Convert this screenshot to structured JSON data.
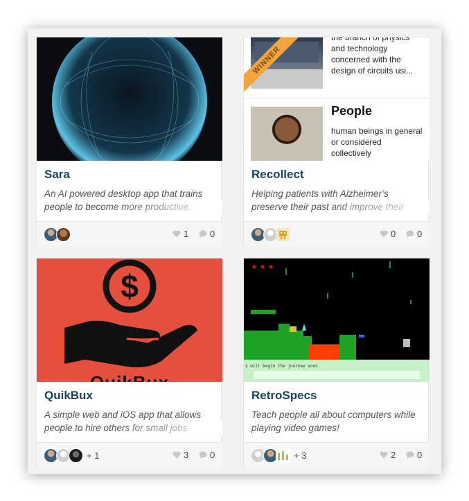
{
  "cards": [
    {
      "title": "Sara",
      "description": "An AI powered desktop app that trains people to become more productive.",
      "likes": "1",
      "comments": "0",
      "more": ""
    },
    {
      "title": "Recollect",
      "description": "Helping patients with Alzheimer’s preserve their past and improve their",
      "likes": "0",
      "comments": "0",
      "more": "",
      "thumb": {
        "badge": "WINNER",
        "word1_text": "the branch of physics and technology concerned with the design of circuits usi...",
        "word2_title": "People",
        "word2_text": "human beings in general or considered collectively"
      }
    },
    {
      "title": "QuikBux",
      "description": "A simple web and iOS app that allows people to hire others for small jobs",
      "likes": "3",
      "comments": "0",
      "more": "+ 1",
      "thumb": {
        "logo_text": "QuikBux"
      }
    },
    {
      "title": "RetroSpecs",
      "description": "Teach people all about computers while playing video games!",
      "likes": "2",
      "comments": "0",
      "more": "+ 3",
      "thumb": {
        "dialog_text": "s will begin the journey soon."
      }
    }
  ],
  "colors": {
    "title": "#15465c",
    "quikbux_bg": "#e4503d",
    "game_green": "#1fa327",
    "game_lava": "#ff3d00"
  },
  "icons": {
    "like": "heart-icon",
    "comment": "speech-bubble-icon"
  }
}
